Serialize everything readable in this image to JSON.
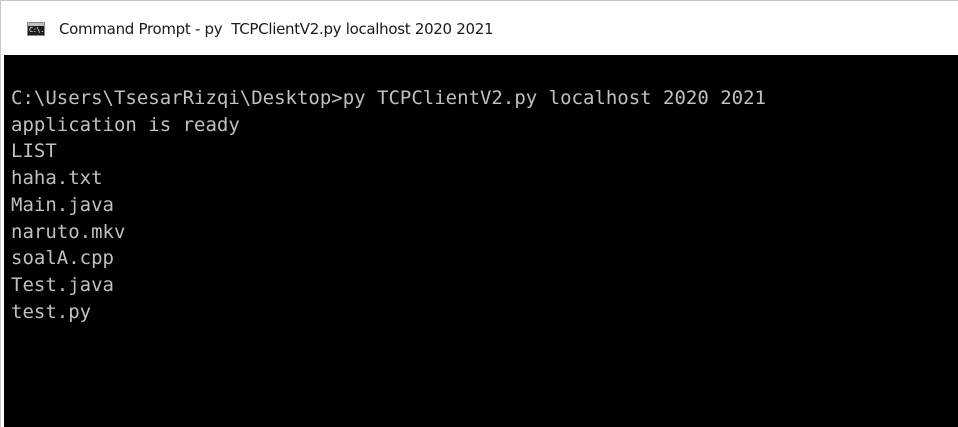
{
  "window": {
    "title": "Command Prompt - py  TCPClientV2.py localhost 2020 2021",
    "icon": "cmd-console-icon",
    "icon_text": "C:\\."
  },
  "console": {
    "lines": [
      "C:\\Users\\TsesarRizqi\\Desktop>py TCPClientV2.py localhost 2020 2021",
      "application is ready",
      "LIST",
      "haha.txt",
      "Main.java",
      "naruto.mkv",
      "soalA.cpp",
      "Test.java",
      "test.py"
    ]
  },
  "colors": {
    "console_background": "#000000",
    "console_text": "#c0c0c0",
    "titlebar_background": "#ffffff"
  }
}
